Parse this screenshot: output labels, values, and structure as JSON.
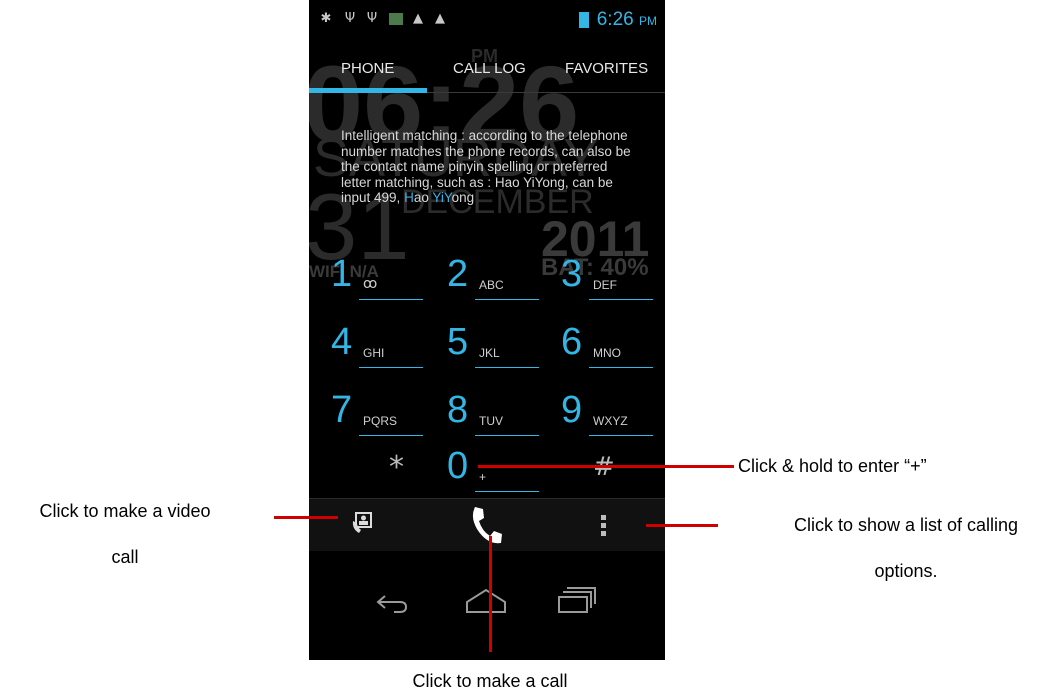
{
  "status_bar": {
    "time": "6:26",
    "ampm": "PM",
    "icons": [
      "bug-icon",
      "usb-icon",
      "usb-icon",
      "image-icon",
      "warning-icon",
      "warning-icon",
      "battery-charging-icon"
    ]
  },
  "wallpaper_clock": {
    "ampm": "PM",
    "time": "06:26",
    "day": "SATURDAY",
    "date": "31",
    "month": "DECEMBER",
    "year": "2011",
    "wifi": "WIFI N/A",
    "battery": "BAT: 40%"
  },
  "tabs": [
    {
      "label": "PHONE",
      "selected": true
    },
    {
      "label": "CALL LOG",
      "selected": false
    },
    {
      "label": "FAVORITES",
      "selected": false
    }
  ],
  "hint": {
    "text_main": "Intelligent matching : according to the telephone number matches the phone records, can also be the contact name pinyin spelling or preferred letter matching, such as : Hao YiYong, can be input 499, ",
    "h1": "H",
    "t1": "ao ",
    "h2": "Yi",
    "h3": "Y",
    "t2": "ong"
  },
  "keypad": [
    {
      "digit": "1",
      "letters": "voicemail-icon"
    },
    {
      "digit": "2",
      "letters": "ABC"
    },
    {
      "digit": "3",
      "letters": "DEF"
    },
    {
      "digit": "4",
      "letters": "GHI"
    },
    {
      "digit": "5",
      "letters": "JKL"
    },
    {
      "digit": "6",
      "letters": "MNO"
    },
    {
      "digit": "7",
      "letters": "PQRS"
    },
    {
      "digit": "8",
      "letters": "TUV"
    },
    {
      "digit": "9",
      "letters": "WXYZ"
    },
    {
      "digit": "*",
      "letters": ""
    },
    {
      "digit": "0",
      "letters": "+"
    },
    {
      "digit": "#",
      "letters": ""
    }
  ],
  "actions": {
    "video_call_icon": "video-call-icon",
    "call_icon": "phone-icon",
    "menu_icon": "overflow-menu-icon"
  },
  "nav": [
    "back-icon",
    "home-icon",
    "recent-apps-icon"
  ],
  "annotations": {
    "hold_plus": "Click & hold to enter “+”",
    "video_call_1": "Click to make a video",
    "video_call_2": "call",
    "options_1": "Click to show a list of calling",
    "options_2": "options.",
    "make_call": "Click to make a call"
  },
  "colors": {
    "accent": "#33b5e5",
    "annotation_line": "#d00000"
  }
}
